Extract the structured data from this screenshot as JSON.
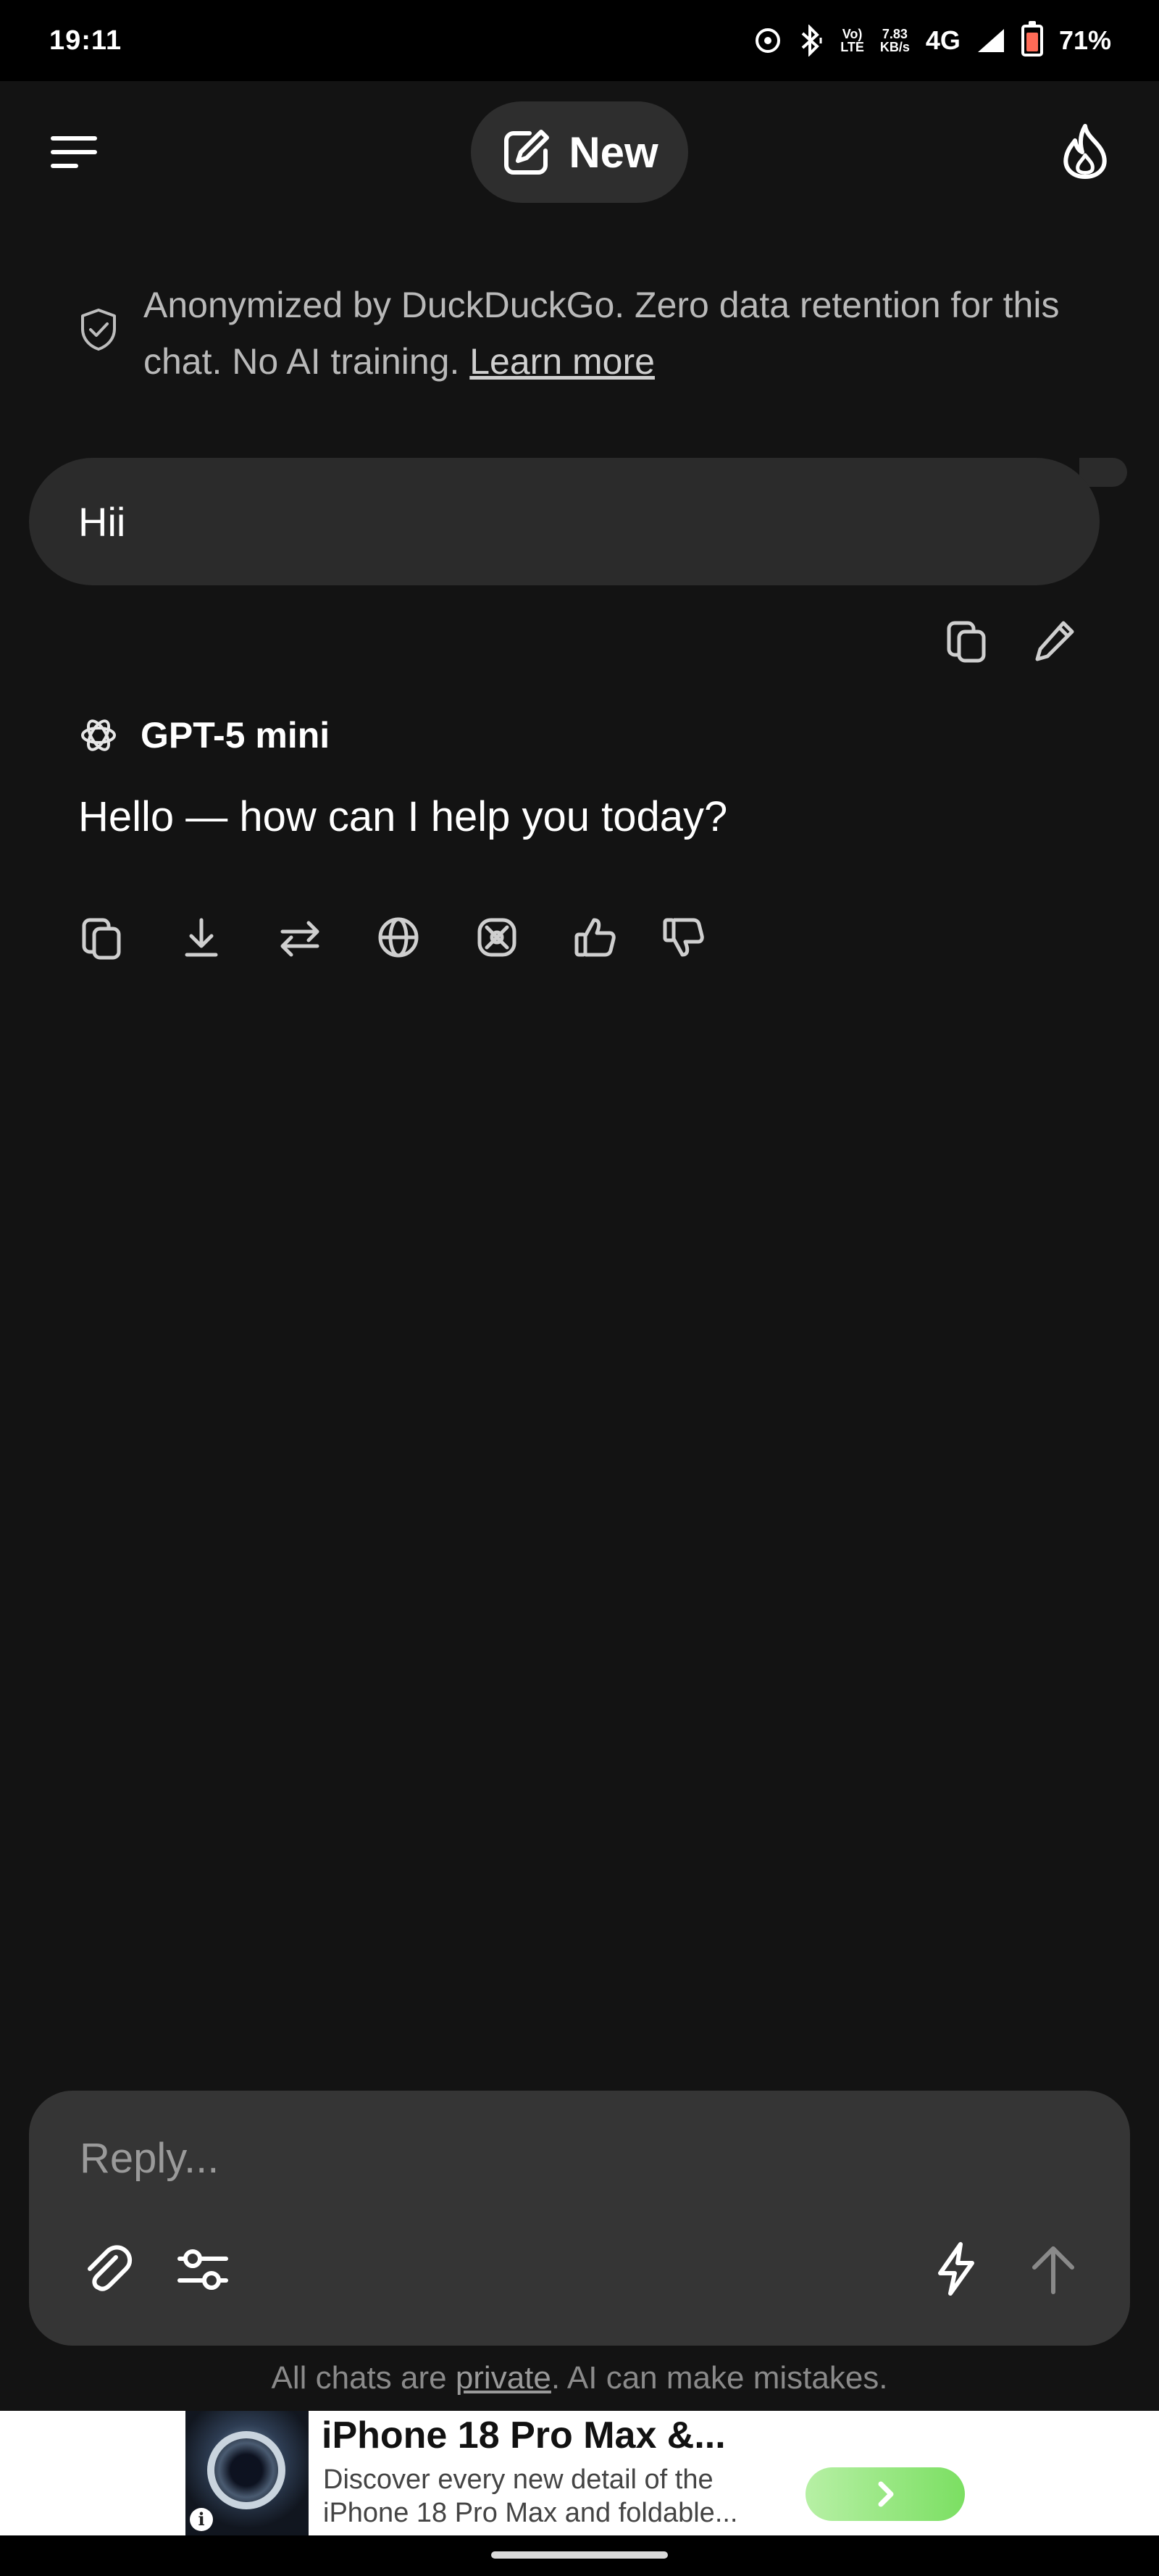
{
  "status_bar": {
    "time": "19:11",
    "volte_line1": "Vo)",
    "volte_line2": "LTE",
    "speed_line1": "7.83",
    "speed_line2": "KB/s",
    "network": "4G",
    "battery": "71%",
    "battery_level": 0.71
  },
  "header": {
    "new_label": "New"
  },
  "notice": {
    "text": "Anonymized by DuckDuckGo. Zero data retention for this chat. No AI training. ",
    "link": "Learn more"
  },
  "user_message": {
    "text": "Hii"
  },
  "assistant": {
    "model_name": "GPT-5 mini",
    "reply": "Hello — how can I help you today?"
  },
  "composer": {
    "placeholder": "Reply..."
  },
  "disclaimer": {
    "prefix": "All chats are ",
    "link": "private",
    "suffix": ". AI can make mistakes."
  },
  "ad": {
    "title": "iPhone 18 Pro Max &...",
    "description_line1": "Discover every new detail of the",
    "description_line2": "iPhone 18 Pro Max and foldable...",
    "info": "i"
  },
  "icons": {
    "menu": "menu-icon",
    "new_chat": "edit-square-icon",
    "fire": "fire-icon",
    "shield": "shield-check-icon",
    "copy": "copy-icon",
    "edit": "pencil-icon",
    "model": "openai-icon",
    "download": "download-icon",
    "regenerate": "swap-icon",
    "web": "globe-icon",
    "reasoning": "atom-icon",
    "thumbs_up": "thumbs-up-icon",
    "thumbs_down": "thumbs-down-icon",
    "attach": "paperclip-icon",
    "settings": "sliders-icon",
    "fast": "bolt-icon",
    "send": "arrow-up-icon"
  }
}
